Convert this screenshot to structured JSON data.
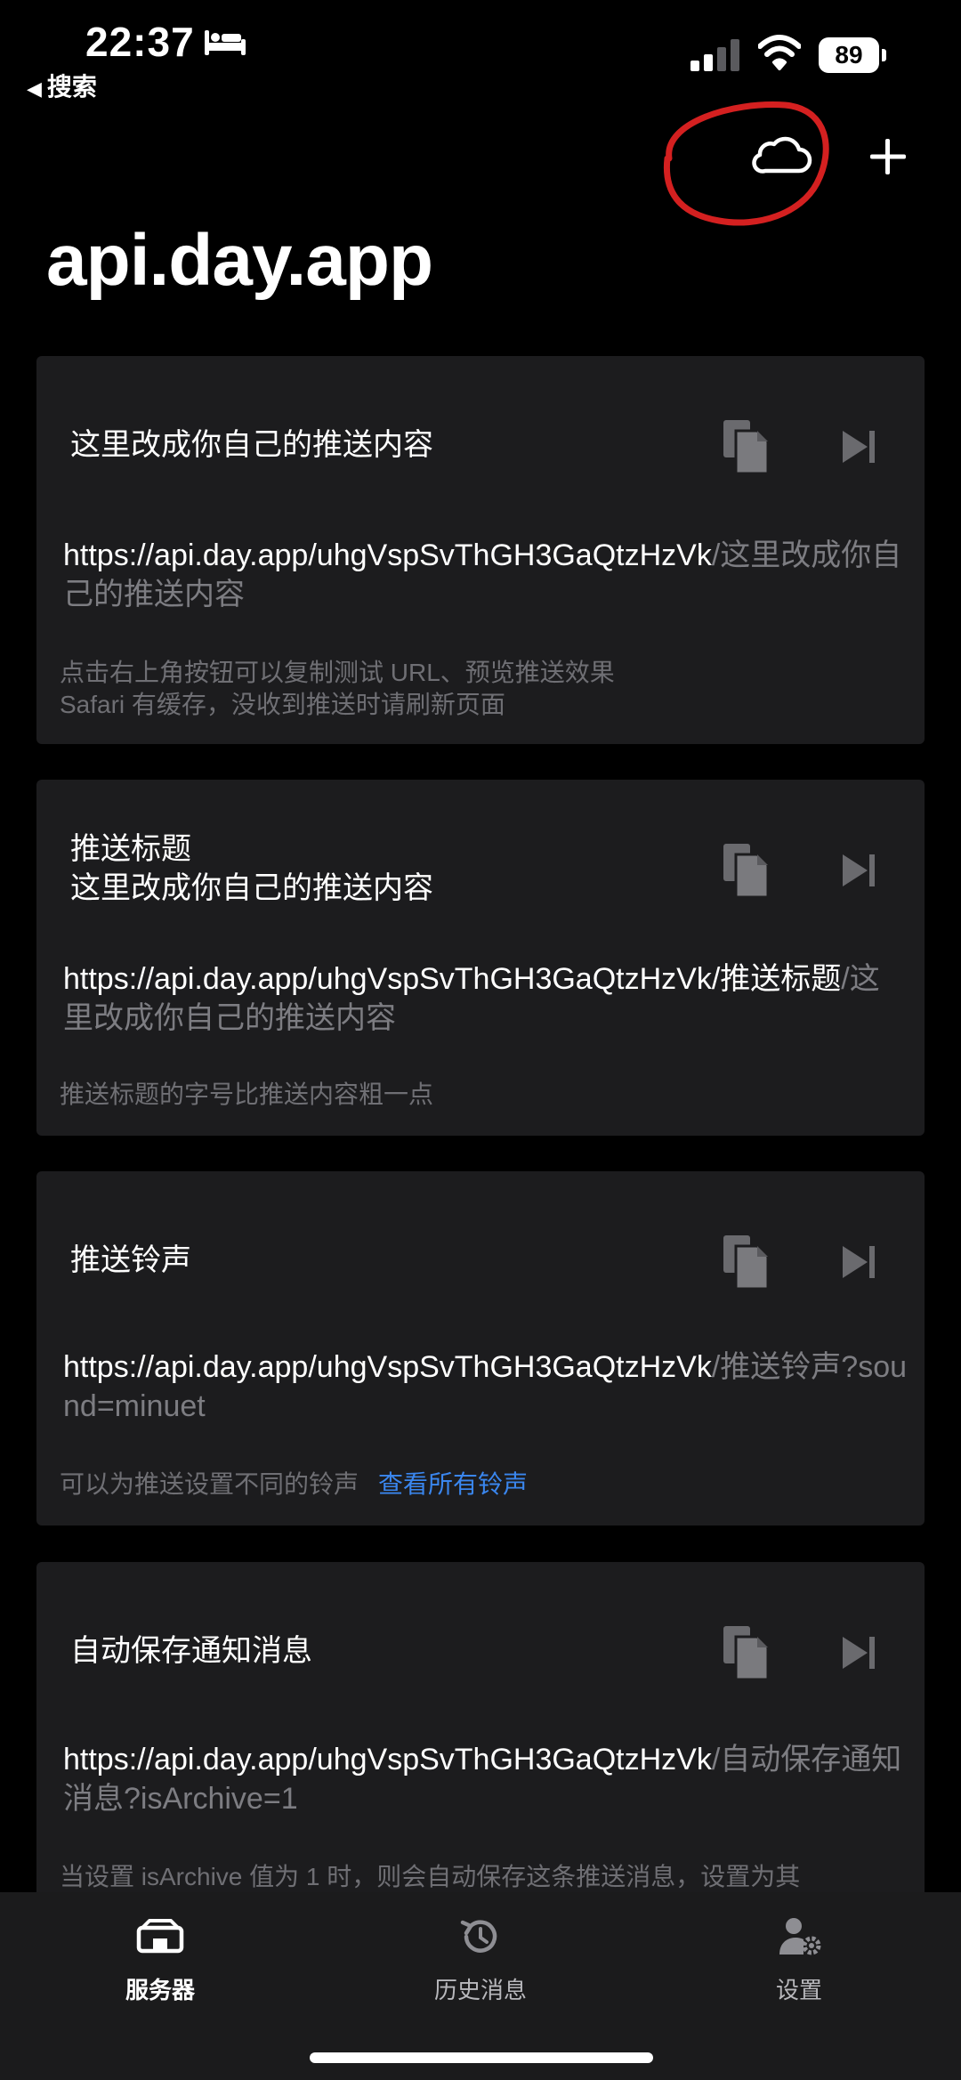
{
  "status_bar": {
    "time": "22:37",
    "back_label": "搜索",
    "battery": "89"
  },
  "header": {
    "title": "api.day.app",
    "cloud_icon": "cloud-icon",
    "plus_icon": "plus-icon"
  },
  "cards": [
    {
      "title": "这里改成你自己的推送内容",
      "url_main": "https://api.day.app/uhgVspSvThGH3GaQtzHzVk",
      "url_rest": "/这里改成你自己的推送内容",
      "note": "点击右上角按钮可以复制测试 URL、预览推送效果\nSafari 有缓存，没收到推送时请刷新页面"
    },
    {
      "title": "推送标题\n这里改成你自己的推送内容",
      "url_main": "https://api.day.app/uhgVspSvThGH3GaQtzHzVk/推送标题",
      "url_rest": "/这里改成你自己的推送内容",
      "note": "推送标题的字号比推送内容粗一点"
    },
    {
      "title": "推送铃声",
      "url_main": "https://api.day.app/uhgVspSvThGH3GaQtzHzVk",
      "url_rest": "/推送铃声?sound=minuet",
      "note": "可以为推送设置不同的铃声",
      "link": "查看所有铃声"
    },
    {
      "title": "自动保存通知消息",
      "url_main": "https://api.day.app/uhgVspSvThGH3GaQtzHzVk",
      "url_rest": "/自动保存通知消息?isArchive=1",
      "note": "当设置 isArchive 值为 1 时，则会自动保存这条推送消息，设置为其"
    }
  ],
  "tab_bar": {
    "tabs": [
      {
        "label": "服务器",
        "icon": "server-icon",
        "active": true
      },
      {
        "label": "历史消息",
        "icon": "history-icon",
        "active": false
      },
      {
        "label": "设置",
        "icon": "settings-icon",
        "active": false
      }
    ]
  },
  "colors": {
    "background": "#000000",
    "card": "#1c1c1e",
    "muted_text": "#7d7d82",
    "link": "#3a86ee",
    "annotation": "#d42020",
    "tab_bar": "#1b1b1c"
  }
}
